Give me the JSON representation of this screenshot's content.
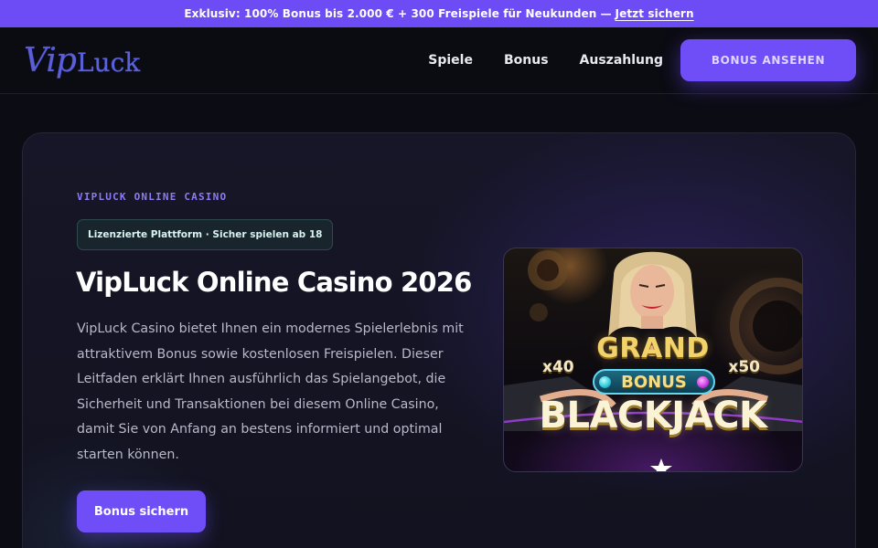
{
  "promo": {
    "text": "Exklusiv: 100% Bonus bis 2.000 € + 300 Freispiele für Neukunden",
    "separator": "—",
    "link": "Jetzt sichern"
  },
  "header": {
    "logo_vip": "Vip",
    "logo_luck": "Luck",
    "nav": [
      "Spiele",
      "Bonus",
      "Auszahlung"
    ],
    "cta": "BONUS ANSEHEN"
  },
  "hero": {
    "eyebrow": "VIPLUCK ONLINE CASINO",
    "badge": "Lizenzierte Plattform · Sicher spielen ab 18",
    "title": "VipLuck Online Casino 2026",
    "description": "VipLuck Casino bietet Ihnen ein modernes Spielerlebnis mit attraktivem Bonus sowie kostenlosen Freispielen. Dieser Leitfaden erklärt Ihnen ausführlich das Spielangebot, die Sicherheit und Transaktionen bei diesem Online Casino, damit Sie von Anfang an bestens informiert und optimal starten können.",
    "cta": "Bonus sichern"
  },
  "game": {
    "line1": "GRAND",
    "line2": "BONUS",
    "line3": "BLACKJACK",
    "mult_left": "x40",
    "mult_right": "x50"
  },
  "colors": {
    "accent": "#6f4df7",
    "promo_bg": "#6d4cf6",
    "background": "#0c0c14",
    "eyebrow": "#8a7cf4"
  }
}
